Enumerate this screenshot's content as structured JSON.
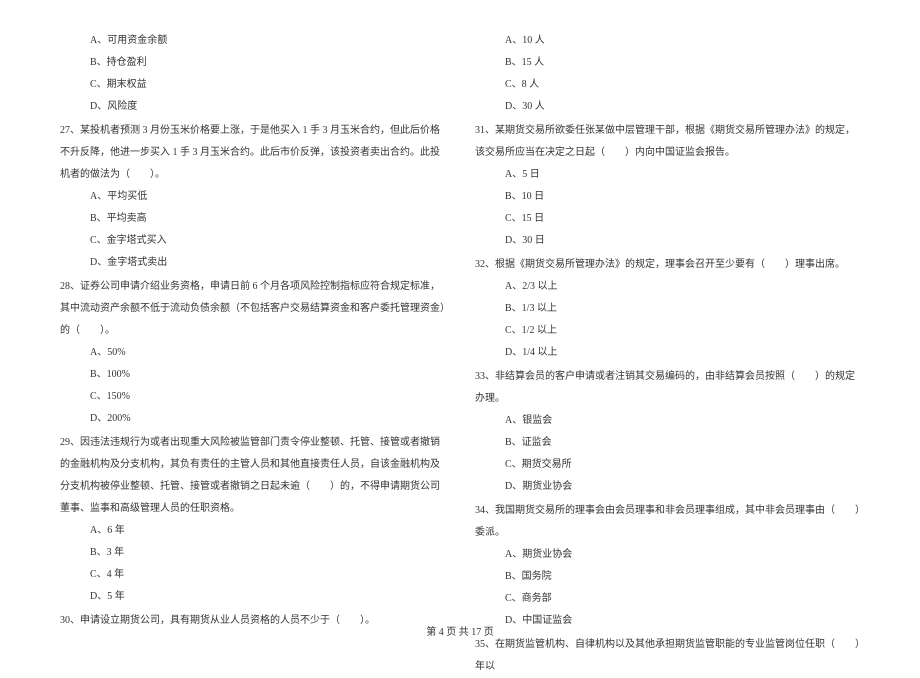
{
  "leftColumn": {
    "q26_options": {
      "a": "A、可用资金余额",
      "b": "B、持仓盈利",
      "c": "C、期末权益",
      "d": "D、风险度"
    },
    "q27": {
      "text": "27、某投机者预测 3 月份玉米价格要上涨，于是他买入 1 手 3 月玉米合约，但此后价格不升反降，他进一步买入 1 手 3 月玉米合约。此后市价反弹，该投资者卖出合约。此投机者的做法为（　　）。",
      "options": {
        "a": "A、平均买低",
        "b": "B、平均卖高",
        "c": "C、金字塔式买入",
        "d": "D、金字塔式卖出"
      }
    },
    "q28": {
      "text": "28、证券公司申请介绍业务资格，申请日前 6 个月各项风险控制指标应符合规定标准，其中流动资产余额不低于流动负债余额（不包括客户交易结算资金和客户委托管理资金）的（　　）。",
      "options": {
        "a": "A、50%",
        "b": "B、100%",
        "c": "C、150%",
        "d": "D、200%"
      }
    },
    "q29": {
      "text": "29、因违法违规行为或者出现重大风险被监管部门责令停业整顿、托管、接管或者撤销的金融机构及分支机构，其负有责任的主管人员和其他直接责任人员，自该金融机构及分支机构被停业整顿、托管、接管或者撤销之日起未逾（　　）的，不得申请期货公司董事、监事和高级管理人员的任职资格。",
      "options": {
        "a": "A、6 年",
        "b": "B、3 年",
        "c": "C、4 年",
        "d": "D、5 年"
      }
    },
    "q30": {
      "text": "30、申请设立期货公司，具有期货从业人员资格的人员不少于（　　）。"
    }
  },
  "rightColumn": {
    "q30_options": {
      "a": "A、10 人",
      "b": "B、15 人",
      "c": "C、8 人",
      "d": "D、30 人"
    },
    "q31": {
      "text": "31、某期货交易所欲委任张某做中层管理干部，根据《期货交易所管理办法》的规定，该交易所应当在决定之日起（　　）内向中国证监会报告。",
      "options": {
        "a": "A、5 日",
        "b": "B、10 日",
        "c": "C、15 日",
        "d": "D、30 日"
      }
    },
    "q32": {
      "text": "32、根据《期货交易所管理办法》的规定，理事会召开至少要有（　　）理事出席。",
      "options": {
        "a": "A、2/3 以上",
        "b": "B、1/3 以上",
        "c": "C、1/2 以上",
        "d": "D、1/4 以上"
      }
    },
    "q33": {
      "text": "33、非结算会员的客户申请或者注销其交易编码的，由非结算会员按照（　　）的规定办理。",
      "options": {
        "a": "A、银监会",
        "b": "B、证监会",
        "c": "C、期货交易所",
        "d": "D、期货业协会"
      }
    },
    "q34": {
      "text": "34、我国期货交易所的理事会由会员理事和非会员理事组成，其中非会员理事由（　　）委派。",
      "options": {
        "a": "A、期货业协会",
        "b": "B、国务院",
        "c": "C、商务部",
        "d": "D、中国证监会"
      }
    },
    "q35": {
      "text": "35、在期货监管机构、自律机构以及其他承担期货监管职能的专业监管岗位任职（　　）年以"
    }
  },
  "footer": "第 4 页 共 17 页"
}
